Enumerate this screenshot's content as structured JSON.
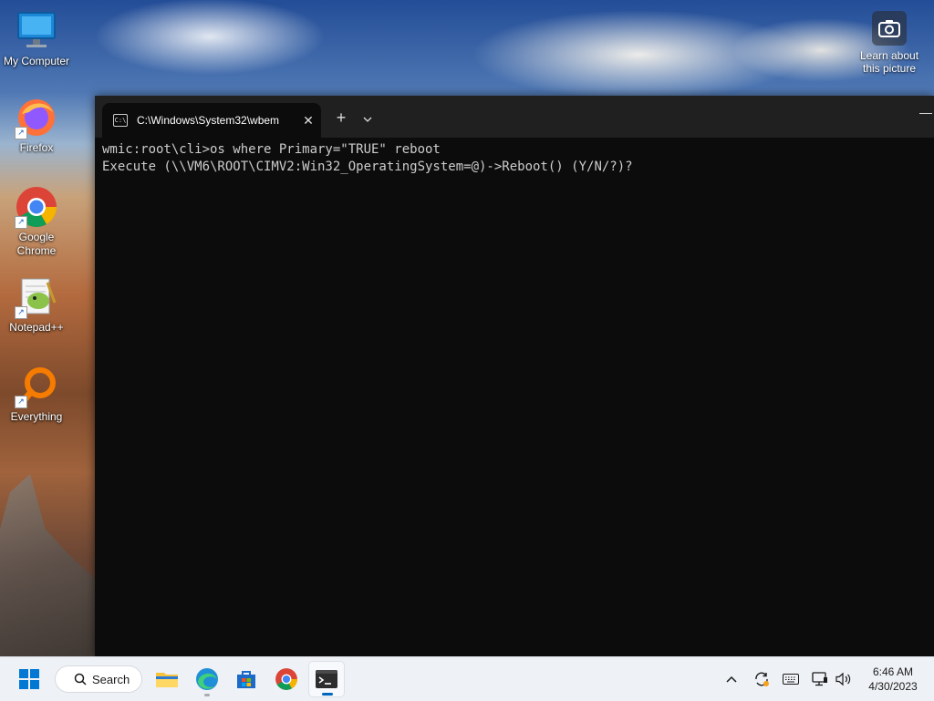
{
  "desktop": {
    "icons": [
      {
        "label": "My Computer"
      },
      {
        "label": "Firefox"
      },
      {
        "label": "Google Chrome"
      },
      {
        "label": "Notepad++"
      },
      {
        "label": "Everything"
      }
    ],
    "learn_label": "Learn about this picture"
  },
  "terminal": {
    "tab_title": "C:\\Windows\\System32\\wbem",
    "tab_icon": "cmd-icon",
    "new_tab_icon": "plus-icon",
    "dropdown_icon": "chevron-down-icon",
    "lines": [
      "wmic:root\\cli>os where Primary=\"TRUE\" reboot",
      "Execute (\\\\VM6\\ROOT\\CIMV2:Win32_OperatingSystem=@)->Reboot() (Y/N/?)?"
    ],
    "background": "#0c0c0c",
    "text_color": "#cccccc"
  },
  "taskbar": {
    "search_label": "Search",
    "apps": [
      "File Explorer",
      "Microsoft Edge",
      "Microsoft Store",
      "Google Chrome",
      "Terminal"
    ],
    "tray_icons": [
      "chevron-up-icon",
      "sync-icon",
      "keyboard-icon",
      "network-icon",
      "speaker-icon"
    ],
    "time": "6:46 AM",
    "date": "4/30/2023",
    "accent": "#0067c0"
  }
}
